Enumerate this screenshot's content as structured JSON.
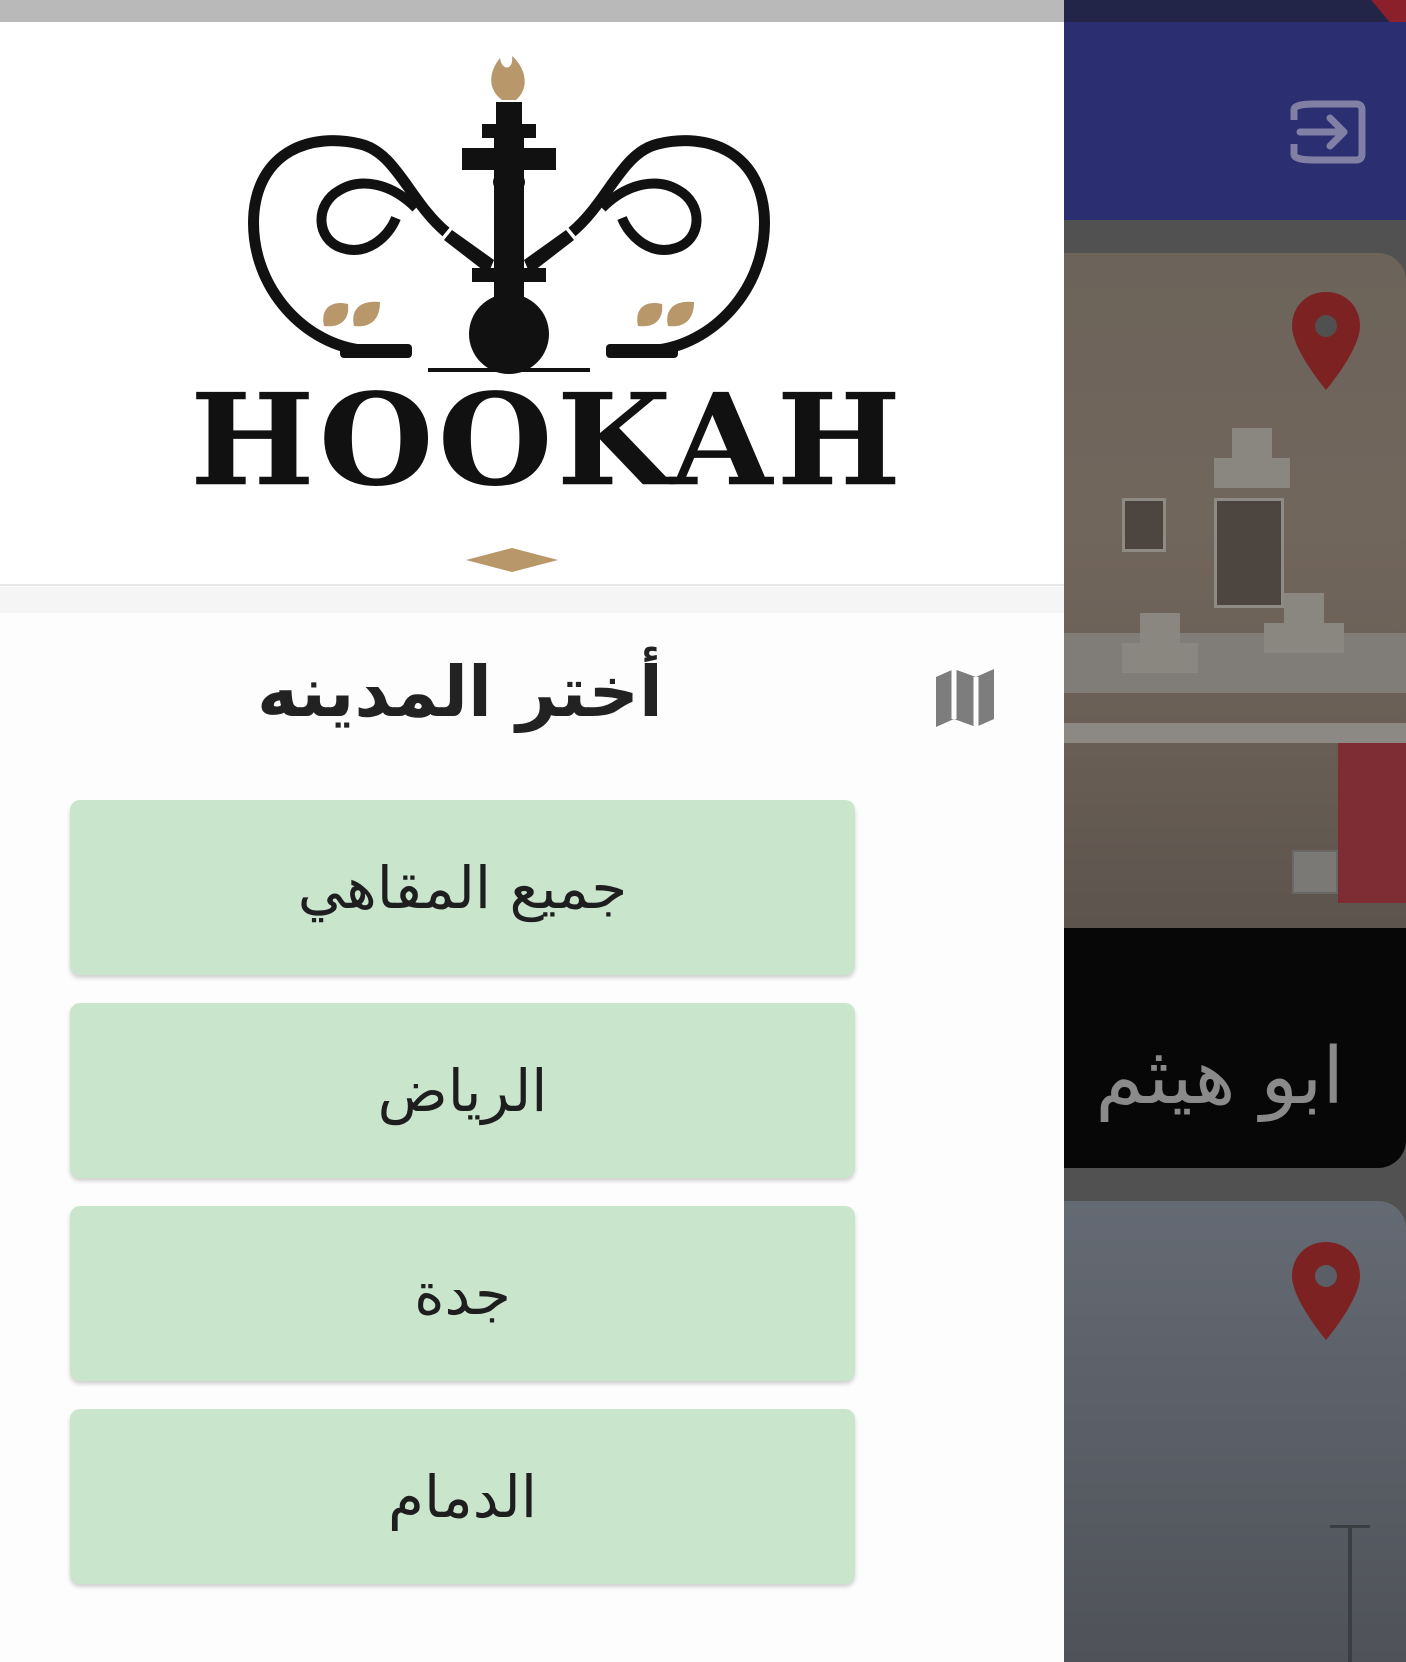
{
  "colors": {
    "drawer_bg": "#fdfdfd",
    "button_bg": "#c9e6cd",
    "appbar": "#2c2e72",
    "pin": "#c62828",
    "logo_accent": "#b8976b"
  },
  "drawer": {
    "logo_text": "HOOKAH",
    "section_title": "أختر المدينه",
    "section_icon": "map-icon",
    "cities": [
      {
        "label": "جميع المقاهي"
      },
      {
        "label": "الرياض"
      },
      {
        "label": "جدة"
      },
      {
        "label": "الدمام"
      }
    ]
  },
  "background": {
    "appbar_icon": "logout-icon",
    "cards": [
      {
        "caption": "ابو هيثم",
        "icon": "location-pin-icon"
      },
      {
        "caption": "",
        "icon": "location-pin-icon"
      }
    ]
  }
}
